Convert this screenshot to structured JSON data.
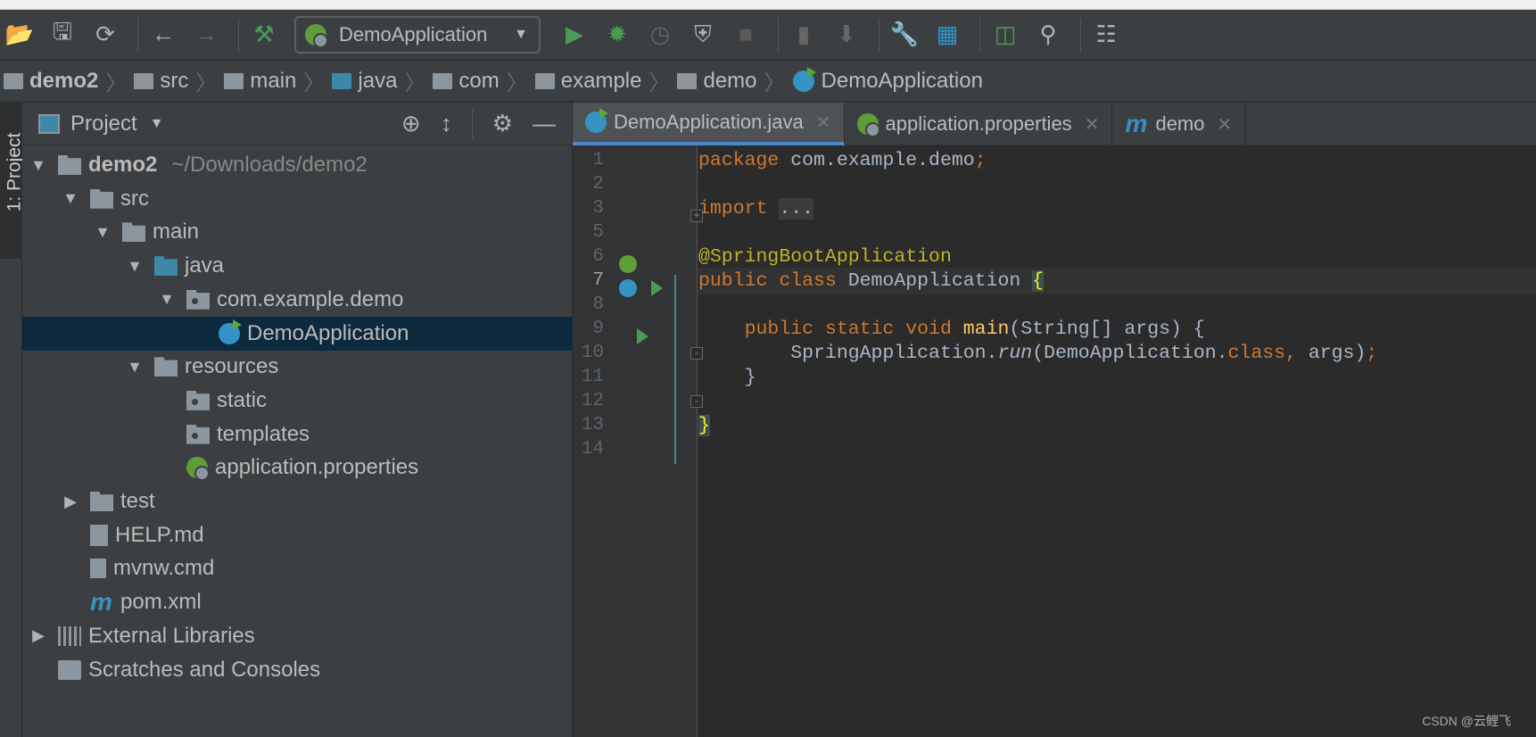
{
  "toolbar": {
    "run_config": "DemoApplication",
    "icons": [
      "open-folder-icon",
      "save-icon",
      "sync-icon",
      "back-icon",
      "forward-icon",
      "build-hammer-icon",
      "run-icon",
      "debug-icon",
      "profile-icon",
      "coverage-icon",
      "stop-icon",
      "android-device-icon",
      "sdk-download-icon",
      "settings-wrench-icon",
      "project-structure-icon",
      "terminal-icon",
      "search-icon",
      "device-manager-icon"
    ]
  },
  "breadcrumb": [
    "demo2",
    "src",
    "main",
    "java",
    "com",
    "example",
    "demo",
    "DemoApplication"
  ],
  "left_strip": {
    "tab": "1: Project"
  },
  "project_panel": {
    "title": "Project",
    "tree": [
      {
        "label": "demo2",
        "path": "~/Downloads/demo2",
        "level": 0,
        "expanded": true,
        "icon": "module"
      },
      {
        "label": "src",
        "level": 1,
        "expanded": true,
        "icon": "folder"
      },
      {
        "label": "main",
        "level": 2,
        "expanded": true,
        "icon": "folder"
      },
      {
        "label": "java",
        "level": 3,
        "expanded": true,
        "icon": "source-folder"
      },
      {
        "label": "com.example.demo",
        "level": 4,
        "expanded": true,
        "icon": "package"
      },
      {
        "label": "DemoApplication",
        "level": 5,
        "icon": "spring-class",
        "selected": true
      },
      {
        "label": "resources",
        "level": 3,
        "expanded": true,
        "icon": "resources-folder"
      },
      {
        "label": "static",
        "level": 4,
        "icon": "package"
      },
      {
        "label": "templates",
        "level": 4,
        "icon": "package"
      },
      {
        "label": "application.properties",
        "level": 4,
        "icon": "spring"
      },
      {
        "label": "test",
        "level": 1,
        "expanded": false,
        "icon": "folder"
      },
      {
        "label": "HELP.md",
        "level": 1,
        "icon": "markdown"
      },
      {
        "label": "mvnw.cmd",
        "level": 1,
        "icon": "text"
      },
      {
        "label": "pom.xml",
        "level": 1,
        "icon": "maven"
      },
      {
        "label": "External Libraries",
        "level": 0,
        "expanded": false,
        "icon": "libraries"
      },
      {
        "label": "Scratches and Consoles",
        "level": 0,
        "icon": "scratches"
      }
    ]
  },
  "tabs": [
    {
      "label": "DemoApplication.java",
      "active": true
    },
    {
      "label": "application.properties"
    },
    {
      "label": "demo"
    }
  ],
  "editor": {
    "line_numbers": [
      "1",
      "2",
      "3",
      "5",
      "6",
      "7",
      "8",
      "9",
      "10",
      "11",
      "12",
      "13",
      "14"
    ],
    "current_line": "7",
    "code": {
      "l1_kw": "package",
      "l1_rest": " com.example.demo",
      "l1_semi": ";",
      "l3_kw": "import",
      "l3_dots": "...",
      "l6_ann": "@SpringBootApplication",
      "l7_kw": "public class",
      "l7_name": " DemoApplication ",
      "l7_brace": "{",
      "l9_kw": "    public static void",
      "l9_fn": " main",
      "l9_rest": "(String[] args) {",
      "l10_a": "        SpringApplication.",
      "l10_run": "run",
      "l10_b": "(DemoApplication.",
      "l10_kw": "class,",
      "l10_c": " args)",
      "l10_semi": ";",
      "l11": "    }",
      "l13_brace": "}"
    }
  },
  "watermark": "CSDN @云鲤飞",
  "colors": {
    "editor_bg": "#2b2b2b",
    "panel_bg": "#3c3f41",
    "selection": "#0d293e",
    "keyword": "#cc7832",
    "annotation": "#bbb529",
    "accent": "#4a88c7"
  }
}
